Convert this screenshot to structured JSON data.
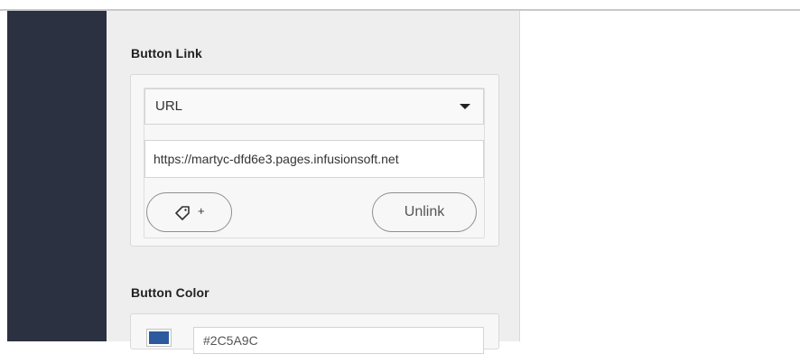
{
  "sections": {
    "button_link": {
      "title": "Button Link",
      "link_type": "URL",
      "url_value": "https://martyc-dfd6e3.pages.infusionsoft.net",
      "tag_button_plus": "+",
      "unlink_label": "Unlink"
    },
    "button_color": {
      "title": "Button Color",
      "hex_value": "#2C5A9C",
      "swatch_color": "#2c5a9c"
    }
  },
  "colors": {
    "sidebar": "#2c3141",
    "panel": "#eeeeee"
  },
  "icons": {
    "tag": "tag-icon",
    "dropdown": "chevron-down-icon"
  }
}
